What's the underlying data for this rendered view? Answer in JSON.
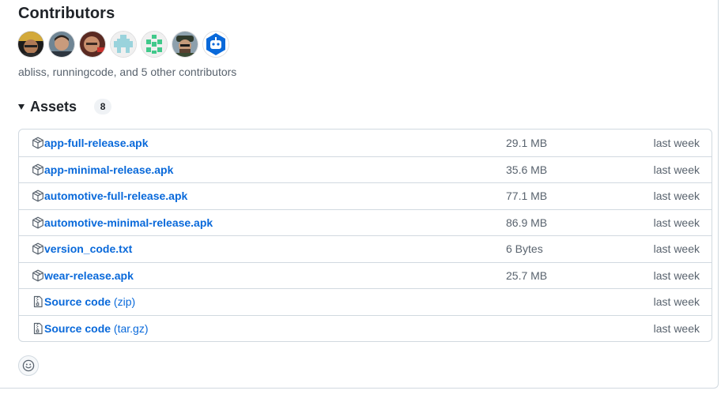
{
  "contributors": {
    "title": "Contributors",
    "avatars": [
      {
        "name": "contributor-1",
        "color": "#3a2b22"
      },
      {
        "name": "contributor-2",
        "color": "#2f3b46"
      },
      {
        "name": "contributor-3",
        "color": "#7a3b30"
      },
      {
        "name": "contributor-4",
        "color": "#9ad3dc"
      },
      {
        "name": "contributor-5",
        "color": "#41c98b"
      },
      {
        "name": "contributor-6",
        "color": "#4a5a3a"
      },
      {
        "name": "bot",
        "color": "#0969da"
      }
    ],
    "summary": "abliss, runningcode, and 5 other contributors"
  },
  "assets": {
    "title": "Assets",
    "count": "8",
    "rows": [
      {
        "name": "app-full-release.apk",
        "ext": "",
        "size": "29.1 MB",
        "time": "last week",
        "icon": "package-icon"
      },
      {
        "name": "app-minimal-release.apk",
        "ext": "",
        "size": "35.6 MB",
        "time": "last week",
        "icon": "package-icon"
      },
      {
        "name": "automotive-full-release.apk",
        "ext": "",
        "size": "77.1 MB",
        "time": "last week",
        "icon": "package-icon"
      },
      {
        "name": "automotive-minimal-release.apk",
        "ext": "",
        "size": "86.9 MB",
        "time": "last week",
        "icon": "package-icon"
      },
      {
        "name": "version_code.txt",
        "ext": "",
        "size": "6 Bytes",
        "time": "last week",
        "icon": "package-icon"
      },
      {
        "name": "wear-release.apk",
        "ext": "",
        "size": "25.7 MB",
        "time": "last week",
        "icon": "package-icon"
      },
      {
        "name": "Source code",
        "ext": "(zip)",
        "size": "",
        "time": "last week",
        "icon": "file-zip-icon"
      },
      {
        "name": "Source code",
        "ext": "(tar.gz)",
        "size": "",
        "time": "last week",
        "icon": "file-zip-icon"
      }
    ]
  },
  "colors": {
    "link": "#0969da",
    "muted": "#59636e",
    "border": "#d1d9e0"
  },
  "reaction": {
    "icon": "smiley-icon"
  }
}
